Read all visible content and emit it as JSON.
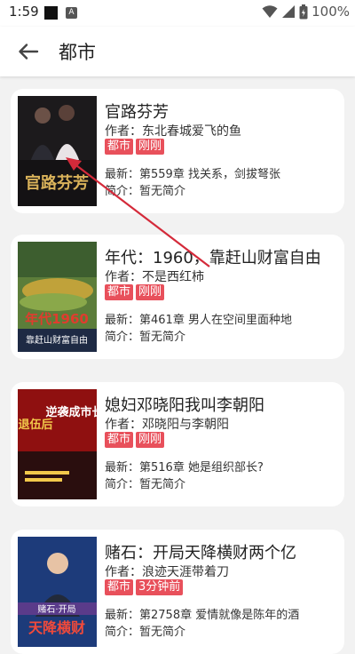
{
  "status": {
    "time": "1:59",
    "battery": "100%"
  },
  "appbar": {
    "title": "都市"
  },
  "labels": {
    "author_prefix": "作者：",
    "latest_prefix": "最新：",
    "intro_prefix": "简介："
  },
  "books": [
    {
      "title": "官路芬芳",
      "author": "东北春城爱飞的鱼",
      "tags": [
        "都市",
        "刚刚"
      ],
      "latest": "第559章 找关系，剑拔弩张",
      "intro": "暂无简介",
      "cover_text": "官路芬芳"
    },
    {
      "title": "年代：1960，靠赶山财富自由",
      "author": "不是西红柿",
      "tags": [
        "都市",
        "刚刚"
      ],
      "latest": "第461章 男人在空间里面种地",
      "intro": "暂无简介",
      "cover_text": "年代1960",
      "cover_sub": "靠赶山财富自由"
    },
    {
      "title": "媳妇邓晓阳我叫李朝阳",
      "author": "邓晓阳与李朝阳",
      "tags": [
        "都市",
        "刚刚"
      ],
      "latest": "第516章 她是组织部长?",
      "intro": "暂无简介",
      "cover_text": "逆袭成市长",
      "cover_sub": "退伍后"
    },
    {
      "title": "赌石：开局天降横财两个亿",
      "author": "浪迹天涯带着刀",
      "tags": [
        "都市",
        "3分钟前"
      ],
      "latest": "第2758章 爱情就像是陈年的酒",
      "intro": "暂无简介",
      "cover_text": "天降横财",
      "cover_sub": "赌石·开局"
    }
  ],
  "colors": {
    "tag": "#e8505b",
    "annotation_arrow": "#d42a3a"
  }
}
